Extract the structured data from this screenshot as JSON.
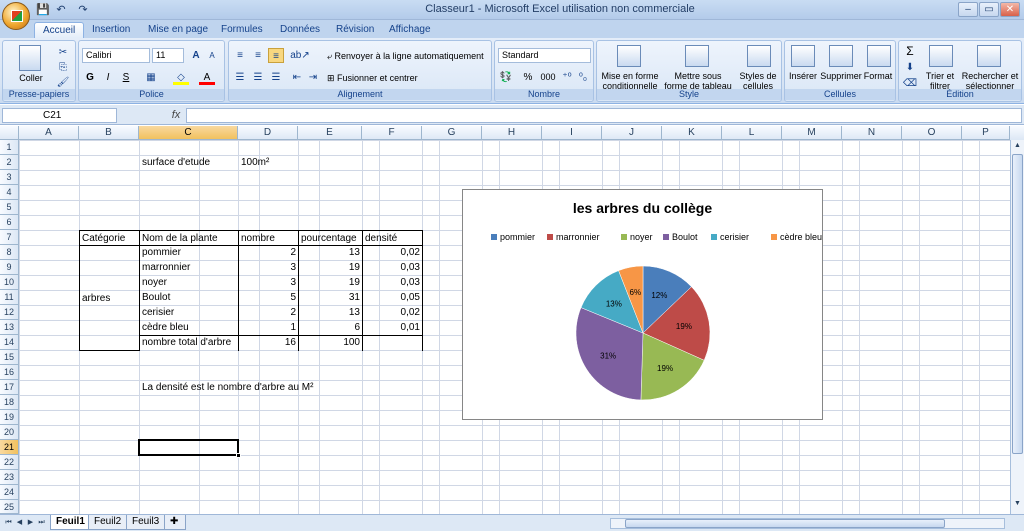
{
  "window": {
    "title": "Classeur1 - Microsoft Excel utilisation non commerciale",
    "min": "–",
    "max": "▭",
    "close": "✕"
  },
  "qat": {
    "save": "💾",
    "undo": "↶",
    "redo": "↷"
  },
  "tabs": [
    "Accueil",
    "Insertion",
    "Mise en page",
    "Formules",
    "Données",
    "Révision",
    "Affichage"
  ],
  "ribbon": {
    "clipboard": {
      "paste": "Coller",
      "label": "Presse-papiers"
    },
    "font": {
      "name": "Calibri",
      "size": "11",
      "grow": "A",
      "shrink": "A",
      "bold": "G",
      "italic": "I",
      "underline": "S",
      "label": "Police"
    },
    "alignment": {
      "wrap": "Renvoyer à la ligne automatiquement",
      "merge": "Fusionner et centrer",
      "label": "Alignement"
    },
    "number": {
      "format": "Standard",
      "pct": "%",
      "thousands": "000",
      "label": "Nombre"
    },
    "style": {
      "cond": "Mise en forme conditionnelle",
      "table": "Mettre sous forme de tableau",
      "cellstyles": "Styles de cellules",
      "label": "Style"
    },
    "cells": {
      "insert": "Insérer",
      "delete": "Supprimer",
      "format": "Format",
      "label": "Cellules"
    },
    "editing": {
      "sum": "Σ",
      "sort": "Trier et filtrer",
      "find": "Rechercher et sélectionner",
      "label": "Édition"
    }
  },
  "formula_bar": {
    "name_box": "C21",
    "fx": "fx",
    "value": ""
  },
  "columns": [
    "A",
    "B",
    "C",
    "D",
    "E",
    "F",
    "G",
    "H",
    "I",
    "J",
    "K",
    "L",
    "M",
    "N",
    "O",
    "P"
  ],
  "rows": [
    "1",
    "2",
    "3",
    "4",
    "5",
    "6",
    "7",
    "8",
    "9",
    "10",
    "11",
    "12",
    "13",
    "14",
    "15",
    "16",
    "17",
    "18",
    "19",
    "20",
    "21",
    "22",
    "23",
    "24",
    "25"
  ],
  "sheet": {
    "c2": "surface d'etude",
    "d2": "100m²",
    "headers": [
      "Catégorie",
      "Nom de la plante",
      "nombre",
      "pourcentage",
      "densité"
    ],
    "category": "arbres",
    "data": [
      {
        "name": "pommier",
        "nombre": "2",
        "pct": "13",
        "densite": "0,02"
      },
      {
        "name": "marronnier",
        "nombre": "3",
        "pct": "19",
        "densite": "0,03"
      },
      {
        "name": "noyer",
        "nombre": "3",
        "pct": "19",
        "densite": "0,03"
      },
      {
        "name": "Boulot",
        "nombre": "5",
        "pct": "31",
        "densite": "0,05"
      },
      {
        "name": "cerisier",
        "nombre": "2",
        "pct": "13",
        "densite": "0,02"
      },
      {
        "name": "cèdre bleu",
        "nombre": "1",
        "pct": "6",
        "densite": "0,01"
      }
    ],
    "total_label": "nombre total d'arbre",
    "total_nombre": "16",
    "total_pct": "100",
    "c17": "La densité est le nombre d'arbre au M²"
  },
  "chart_data": {
    "type": "pie",
    "title": "les arbres du collège",
    "categories": [
      "pommier",
      "marronnier",
      "noyer",
      "Boulot",
      "cerisier",
      "cèdre bleu"
    ],
    "values": [
      13,
      19,
      19,
      31,
      13,
      6
    ],
    "labels": [
      "12%",
      "19%",
      "19%",
      "31%",
      "13%",
      "6%"
    ],
    "colors": [
      "#4a7ebb",
      "#be4b48",
      "#98b954",
      "#7d5fa0",
      "#46aac5",
      "#f79646"
    ],
    "legend": "top"
  },
  "sheet_tabs": [
    "Feuil1",
    "Feuil2",
    "Feuil3"
  ]
}
